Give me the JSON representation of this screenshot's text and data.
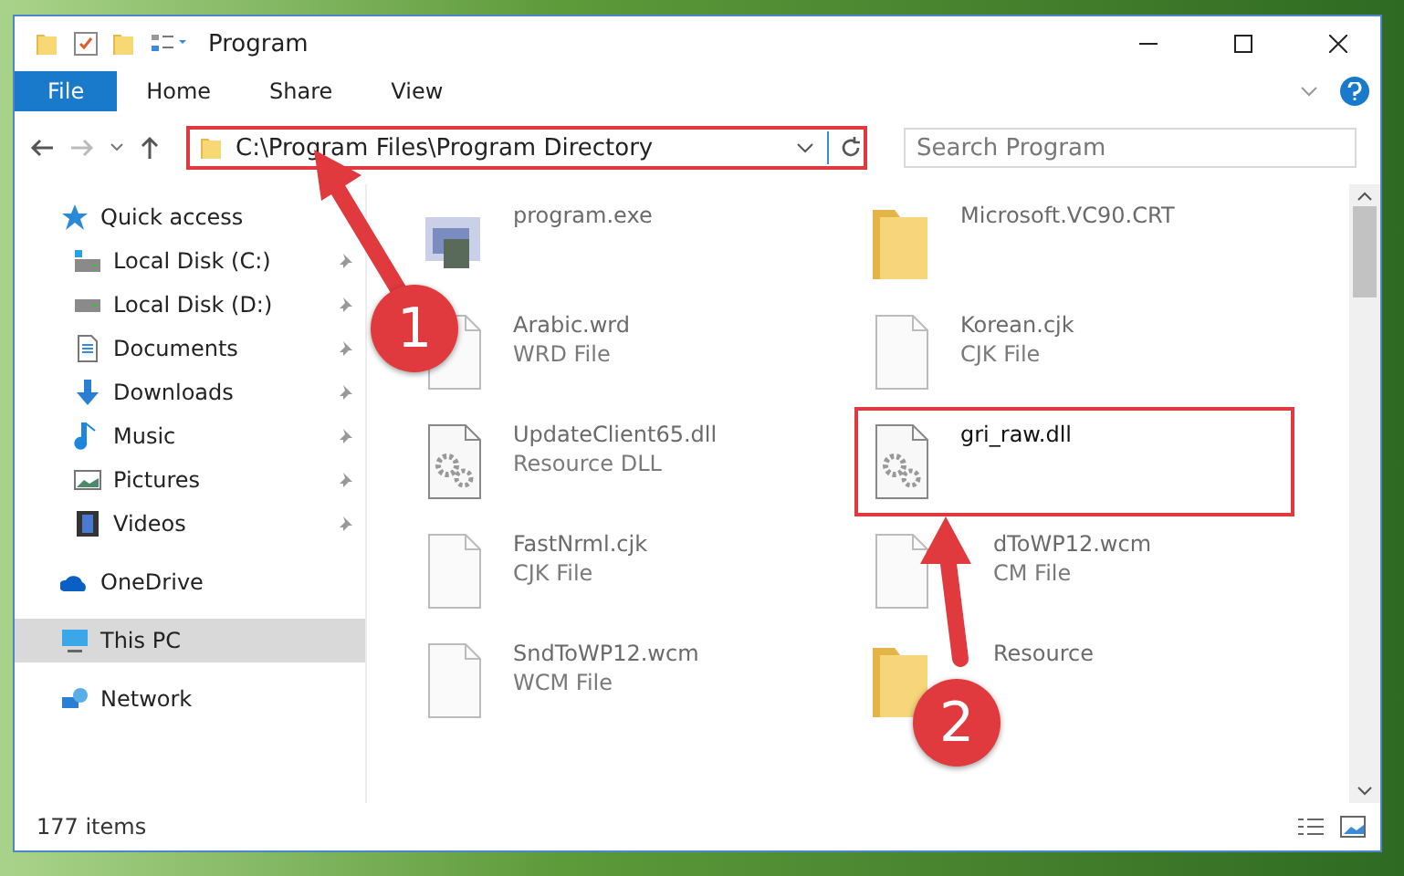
{
  "window": {
    "title": "Program"
  },
  "ribbon_tabs": [
    {
      "label": "File",
      "kind": "file"
    },
    {
      "label": "Home",
      "kind": "tab"
    },
    {
      "label": "Share",
      "kind": "tab"
    },
    {
      "label": "View",
      "kind": "tab"
    }
  ],
  "address_bar": {
    "path": "C:\\Program Files\\Program Directory",
    "highlighted": true
  },
  "search": {
    "placeholder": "Search Program"
  },
  "nav": [
    {
      "label": "Quick access",
      "kind": "quick",
      "selected": false,
      "children": [
        {
          "label": "Local Disk (C:)",
          "kind": "drive-c",
          "pinned": true,
          "selected": false
        },
        {
          "label": "Local Disk (D:)",
          "kind": "drive",
          "pinned": true,
          "selected": false
        },
        {
          "label": "Documents",
          "kind": "documents",
          "pinned": true,
          "selected": false
        },
        {
          "label": "Downloads",
          "kind": "downloads",
          "pinned": true,
          "selected": false
        },
        {
          "label": "Music",
          "kind": "music",
          "pinned": true,
          "selected": false
        },
        {
          "label": "Pictures",
          "kind": "pictures",
          "pinned": true,
          "selected": false
        },
        {
          "label": "Videos",
          "kind": "videos",
          "pinned": true,
          "selected": false
        }
      ]
    },
    {
      "label": "OneDrive",
      "kind": "onedrive",
      "selected": false
    },
    {
      "label": "This PC",
      "kind": "pc",
      "selected": true
    },
    {
      "label": "Network",
      "kind": "network",
      "selected": false
    }
  ],
  "files": [
    {
      "name": "program.exe",
      "kind": "app",
      "highlighted": false
    },
    {
      "name": "Microsoft.VC90.CRT",
      "kind": "folder",
      "highlighted": false
    },
    {
      "name": "Arabic.wrd",
      "type": "WRD File",
      "kind": "doc",
      "highlighted": false
    },
    {
      "name": "Korean.cjk",
      "type": "CJK File",
      "kind": "doc",
      "highlighted": false
    },
    {
      "name": "UpdateClient65.dll",
      "type": "Resource DLL",
      "kind": "dll",
      "highlighted": false
    },
    {
      "name": "gri_raw.dll",
      "kind": "dll",
      "highlighted": true
    },
    {
      "name": "FastNrml.cjk",
      "type": "CJK File",
      "kind": "doc",
      "highlighted": false
    },
    {
      "name": "dToWP12.wcm",
      "type": "CM File",
      "kind": "doc",
      "highlighted": false
    },
    {
      "name": "SndToWP12.wcm",
      "type": "WCM File",
      "kind": "doc",
      "highlighted": false
    },
    {
      "name": "Resource",
      "kind": "folder",
      "highlighted": false
    }
  ],
  "status_bar": {
    "count": "177 items"
  },
  "callouts": [
    {
      "label": "1"
    },
    {
      "label": "2"
    }
  ]
}
